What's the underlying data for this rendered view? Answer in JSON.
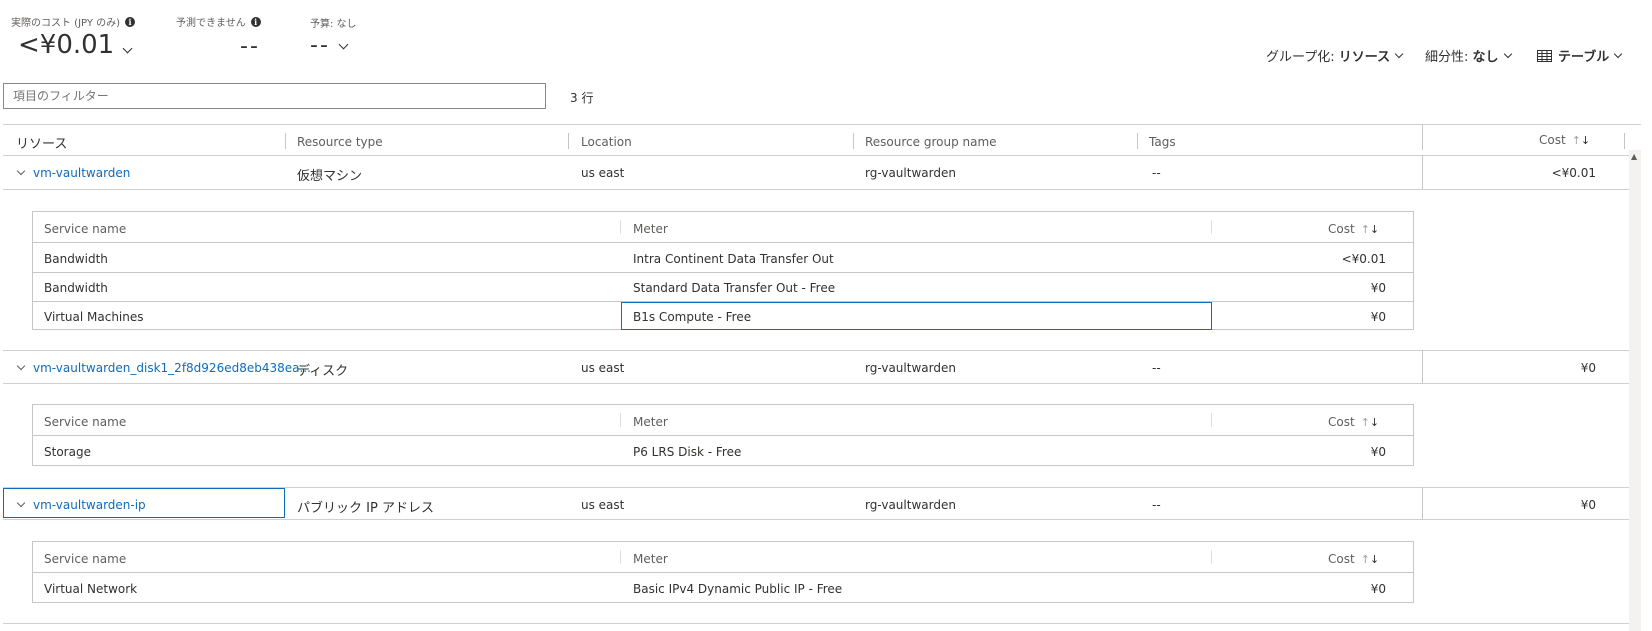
{
  "summary": {
    "actual_cost_label": "実際のコスト (JPY のみ)",
    "actual_cost_value": "<¥0.01",
    "forecast_label": "予測できません",
    "forecast_value": "--",
    "budget_label": "予算: なし",
    "budget_value": "--"
  },
  "view": {
    "group_prefix": "グループ化: ",
    "group_value": "リソース",
    "granularity_prefix": "細分性: ",
    "granularity_value": "なし",
    "view_type": "テーブル"
  },
  "filter": {
    "placeholder": "項目のフィルター",
    "row_count": "3 行"
  },
  "columns": {
    "resource": "リソース",
    "resource_type": "Resource type",
    "location": "Location",
    "resource_group": "Resource group name",
    "tags": "Tags",
    "cost": "Cost"
  },
  "sub_columns": {
    "service_name": "Service name",
    "meter": "Meter",
    "cost": "Cost"
  },
  "rows": [
    {
      "resource": "vm-vaultwarden",
      "type": "仮想マシン",
      "location": "us east",
      "group": "rg-vaultwarden",
      "tags": "--",
      "cost": "<¥0.01",
      "details": [
        {
          "service": "Bandwidth",
          "meter": "Intra Continent Data Transfer Out",
          "cost": "<¥0.01"
        },
        {
          "service": "Bandwidth",
          "meter": "Standard Data Transfer Out - Free",
          "cost": "¥0"
        },
        {
          "service": "Virtual Machines",
          "meter": "B1s Compute - Free",
          "cost": "¥0"
        }
      ]
    },
    {
      "resource": "vm-vaultwarden_disk1_2f8d926ed8eb438ea...",
      "type": "ディスク",
      "location": "us east",
      "group": "rg-vaultwarden",
      "tags": "--",
      "cost": "¥0",
      "details": [
        {
          "service": "Storage",
          "meter": "P6 LRS Disk - Free",
          "cost": "¥0"
        }
      ]
    },
    {
      "resource": "vm-vaultwarden-ip",
      "type": "パブリック IP アドレス",
      "location": "us east",
      "group": "rg-vaultwarden",
      "tags": "--",
      "cost": "¥0",
      "details": [
        {
          "service": "Virtual Network",
          "meter": "Basic IPv4 Dynamic Public IP - Free",
          "cost": "¥0"
        }
      ]
    }
  ]
}
